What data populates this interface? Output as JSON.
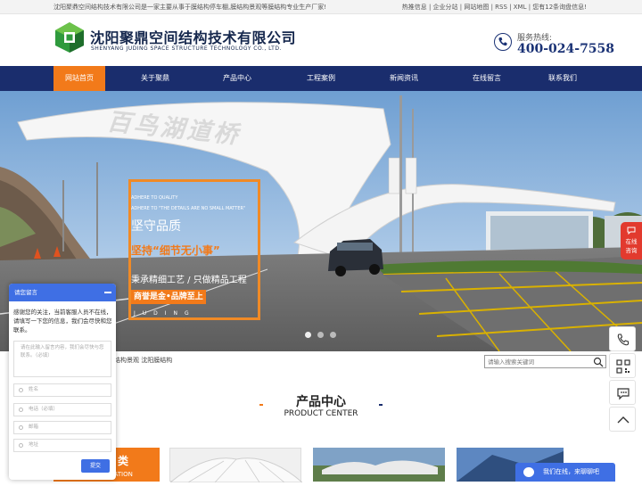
{
  "topbar": {
    "intro": "沈阳聚鼎空间结构技术有限公司是一家主要从事于膜结构停车棚,膜结构景观等膜结构专业生产厂家!",
    "links": "热推信息 | 企业分站 | 网站地图 | RSS | XML | 您有12条询盘信息!"
  },
  "header": {
    "company_cn": "沈阳聚鼎空间结构技术有限公司",
    "company_en": "SHENYANG JUDING SPACE STRUCTURE TECHNOLOGY CO., LTD.",
    "hotline_label": "服务热线:",
    "hotline_number": "400-024-7558"
  },
  "nav": {
    "items": [
      "网站首页",
      "关于聚鼎",
      "产品中心",
      "工程案例",
      "新闻资讯",
      "在线留言",
      "联系我们"
    ],
    "active_index": 0
  },
  "banner": {
    "gate_sign": "百鸟湖道桥",
    "slogan_en1": "ADHERE TO QUALITY",
    "slogan_en2": "ADHERE TO \"THE DETAILS ARE NO SMALL MATTER\"",
    "slogan_h1": "坚守品质",
    "slogan_h2": "坚持“细节无小事”",
    "slogan_t3": "秉承精细工艺 / 只做精品工程",
    "slogan_badge": "商誉是金•品牌至上",
    "slogan_brand": "JUDING",
    "slide_count": 3,
    "active_slide": 0
  },
  "sitebar": {
    "breadcrumb": "结构景观 沈阳膜结构",
    "search_placeholder": "请输入搜索关键词"
  },
  "section": {
    "title": "产品中心",
    "subtitle": "PRODUCT CENTER",
    "category_cn": "类",
    "category_en": "SIFICATION"
  },
  "chat_window": {
    "title": "请您留言",
    "greeting": "感谢您的关注，当前客服人员不在线，请填写一下您的信息，我们会尽快和您联系。",
    "message_placeholder": "请在此输入留言内容，我们会尽快与您联系。（必填）",
    "name_placeholder": "姓名",
    "phone_placeholder": "电话（必填）",
    "email_placeholder": "邮箱",
    "address_placeholder": "地址",
    "submit_label": "提交"
  },
  "float_tab": {
    "line1": "在线",
    "line2": "咨询"
  },
  "chat_bar": {
    "label": "我们在线，来聊聊吧"
  },
  "colors": {
    "nav_blue": "#1a2d6d",
    "accent_orange": "#f27a1a",
    "chat_blue": "#3f6fe4",
    "float_red": "#e23a2e"
  },
  "icons": [
    "logo-mark",
    "phone-icon",
    "search-icon",
    "minimize-icon",
    "qrcode-icon",
    "wechat-icon",
    "arrow-up-icon",
    "chat-bubble-icon"
  ]
}
